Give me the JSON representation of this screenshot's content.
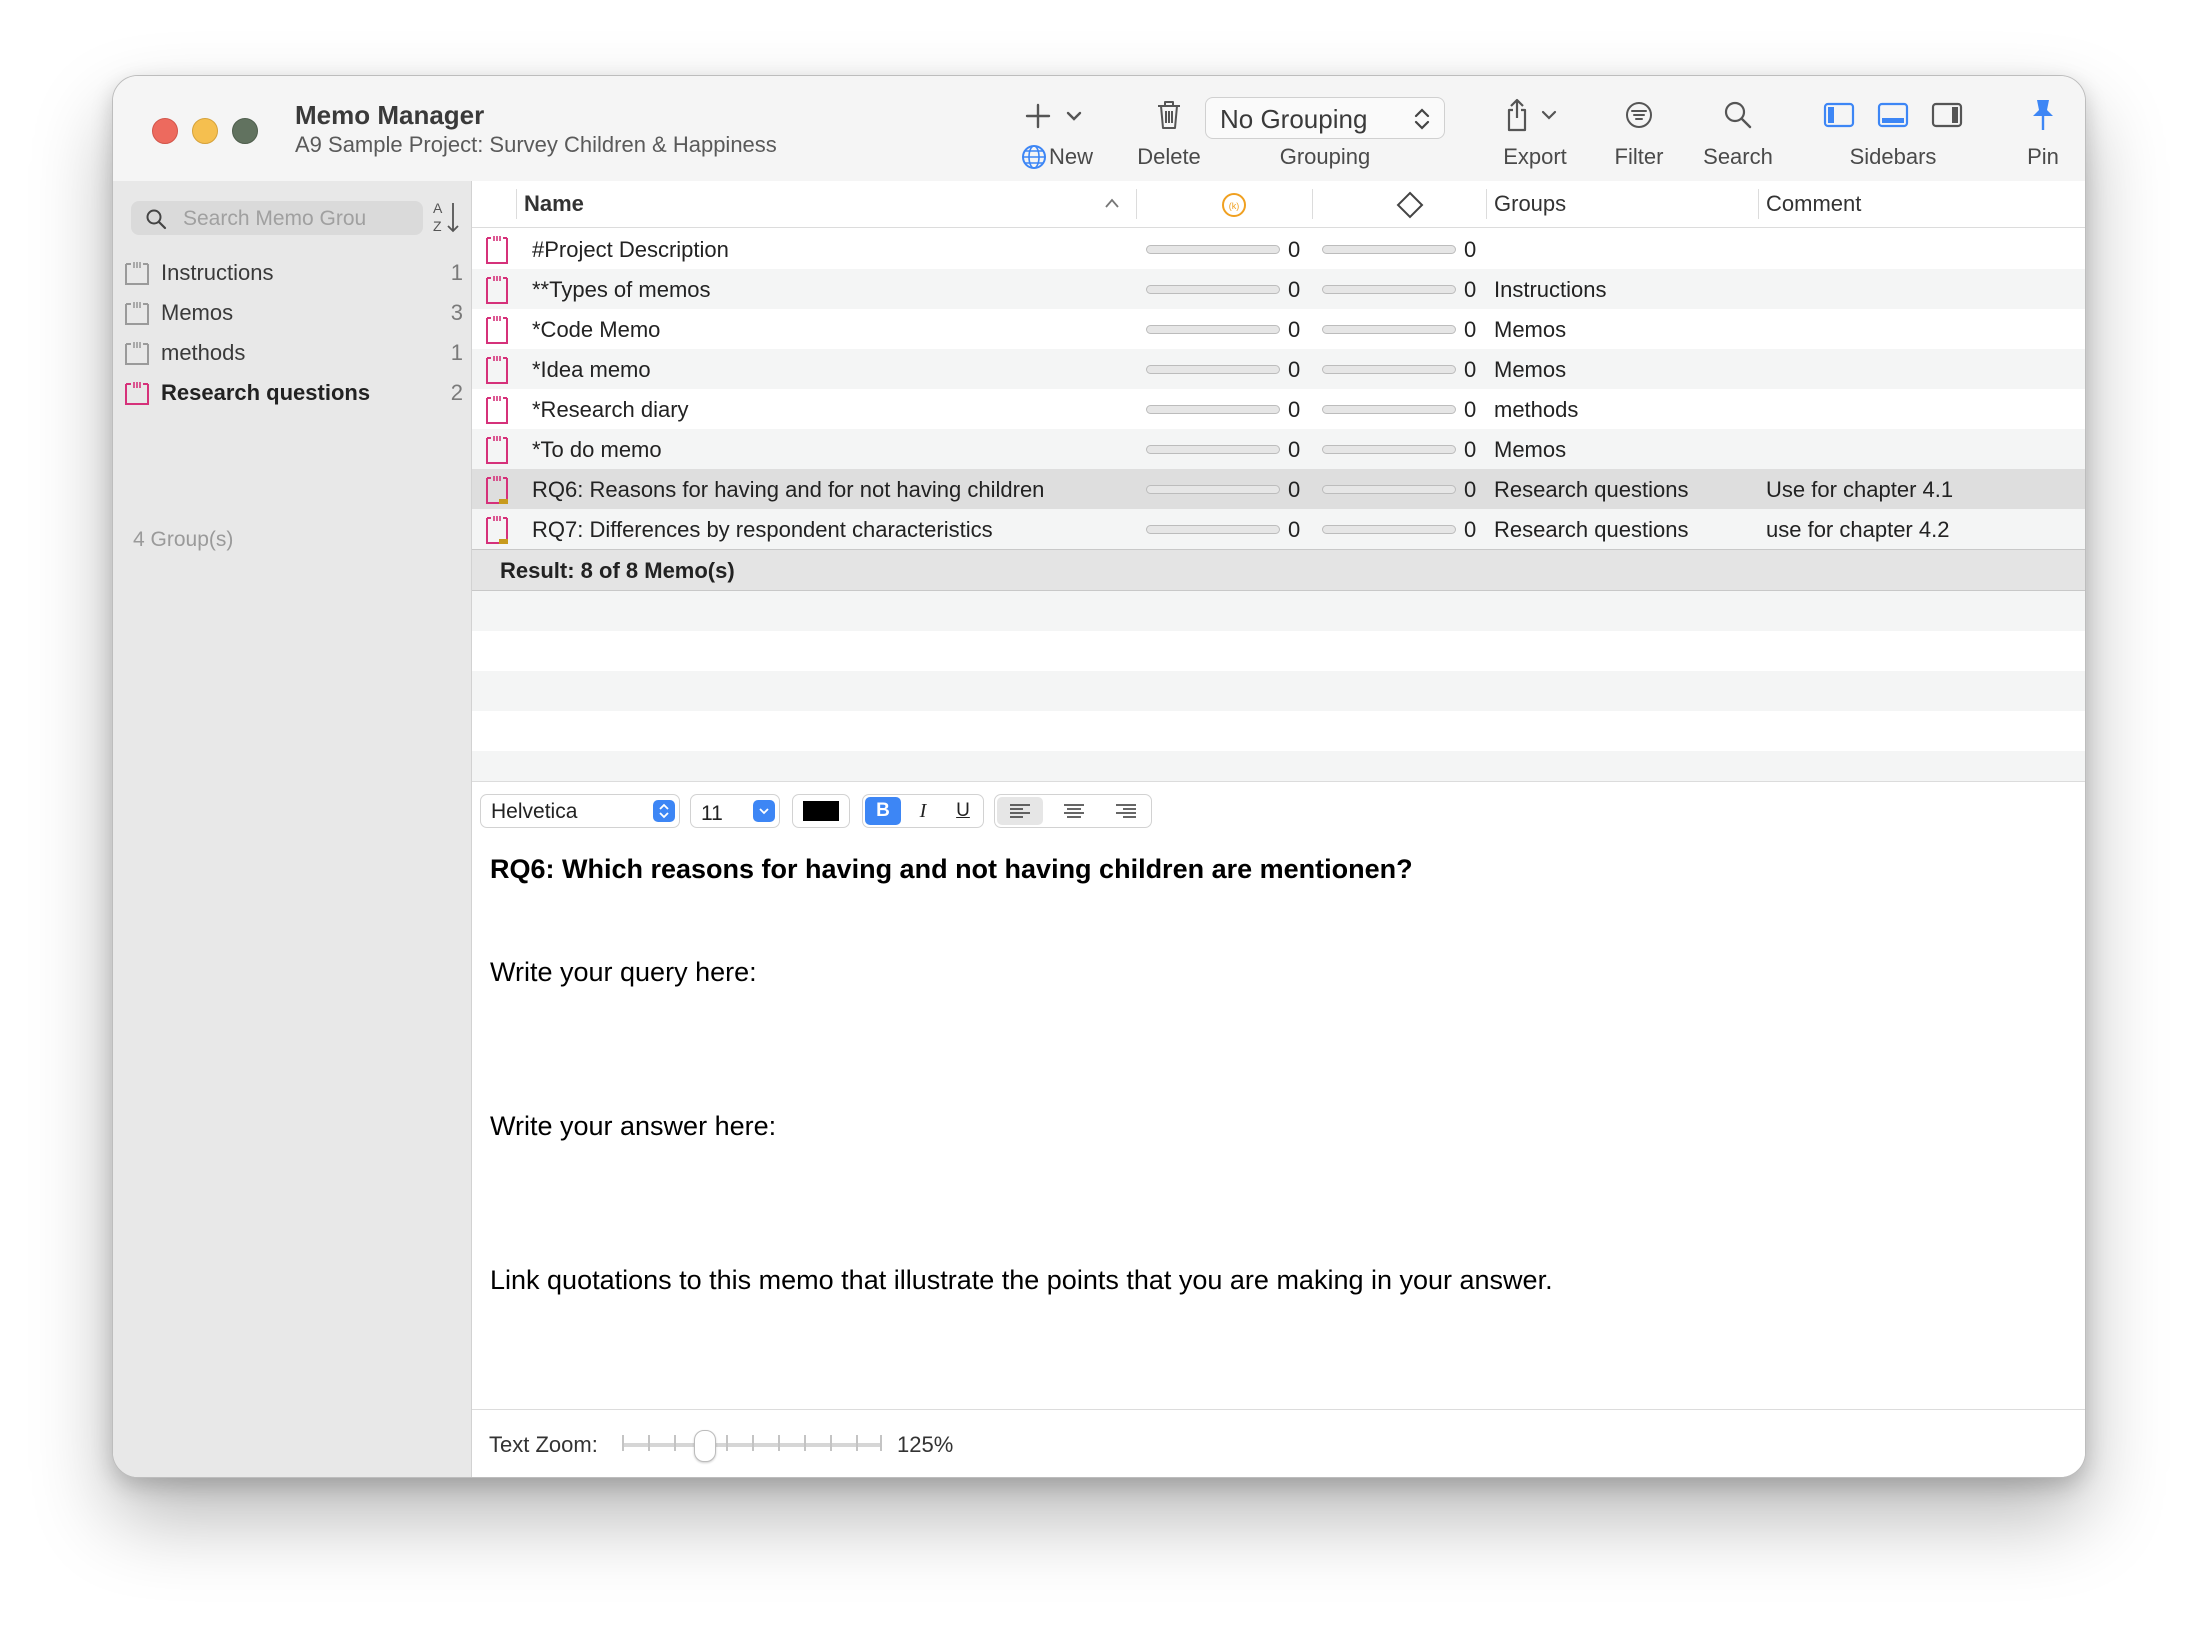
{
  "window": {
    "title": "Memo Manager",
    "subtitle": "A9 Sample Project: Survey Children & Happiness"
  },
  "toolbar": {
    "new_label": "New",
    "delete_label": "Delete",
    "grouping_value": "No Grouping",
    "grouping_label": "Grouping",
    "export_label": "Export",
    "filter_label": "Filter",
    "search_label": "Search",
    "sidebars_label": "Sidebars",
    "pin_label": "Pin"
  },
  "sidebar": {
    "search_placeholder": "Search Memo Grou",
    "groups": [
      {
        "label": "Instructions",
        "count": "1",
        "selected": false
      },
      {
        "label": "Memos",
        "count": "3",
        "selected": false
      },
      {
        "label": "methods",
        "count": "1",
        "selected": false
      },
      {
        "label": "Research questions",
        "count": "2",
        "selected": true
      }
    ],
    "groups_count": "4 Group(s)"
  },
  "table": {
    "columns": {
      "name": "Name",
      "groups": "Groups",
      "comment": "Comment"
    },
    "rows": [
      {
        "name": "#Project Description",
        "v1": "0",
        "v2": "0",
        "groups": "",
        "comment": ""
      },
      {
        "name": "**Types of memos",
        "v1": "0",
        "v2": "0",
        "groups": "Instructions",
        "comment": ""
      },
      {
        "name": "*Code Memo",
        "v1": "0",
        "v2": "0",
        "groups": "Memos",
        "comment": ""
      },
      {
        "name": "*Idea memo",
        "v1": "0",
        "v2": "0",
        "groups": "Memos",
        "comment": ""
      },
      {
        "name": "*Research diary",
        "v1": "0",
        "v2": "0",
        "groups": "methods",
        "comment": ""
      },
      {
        "name": "*To do memo",
        "v1": "0",
        "v2": "0",
        "groups": "Memos",
        "comment": ""
      },
      {
        "name": "RQ6: Reasons for having and for not having children",
        "v1": "0",
        "v2": "0",
        "groups": "Research questions",
        "comment": "Use for chapter 4.1"
      },
      {
        "name": "RQ7: Differences by respondent characteristics",
        "v1": "0",
        "v2": "0",
        "groups": "Research questions",
        "comment": "use for chapter 4.2"
      }
    ],
    "result": "Result: 8 of 8 Memo(s)"
  },
  "format_bar": {
    "font": "Helvetica",
    "size": "11",
    "color": "#000000",
    "bold": "B",
    "italic": "I",
    "underline": "U"
  },
  "editor": {
    "heading": "RQ6: Which reasons for having and not having children are mentionen?",
    "line1": "Write your query here:",
    "line2": "Write your answer here:",
    "line3": "Link quotations to this memo that illustrate the points that you are making in your answer."
  },
  "zoom": {
    "label": "Text Zoom:",
    "value": "125%"
  },
  "colors": {
    "accent": "#3d86f5",
    "memo_icon": "#d6317a",
    "orange": "#f0a020"
  }
}
